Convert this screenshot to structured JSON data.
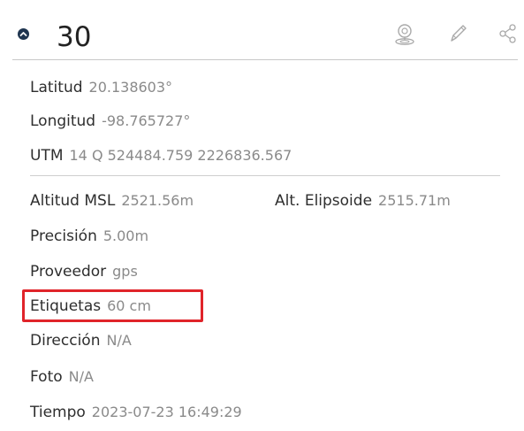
{
  "header": {
    "title": "30",
    "icons": [
      "location-pin-icon",
      "pencil-icon",
      "share-icon"
    ]
  },
  "fields": {
    "latitud": {
      "label": "Latitud",
      "value": "20.138603°"
    },
    "longitud": {
      "label": "Longitud",
      "value": "-98.765727°"
    },
    "utm": {
      "label": "UTM",
      "value": "14 Q 524484.759 2226836.567"
    },
    "altitud_msl": {
      "label": "Altitud MSL",
      "value": "2521.56m"
    },
    "alt_elipsoide": {
      "label": "Alt. Elipsoide",
      "value": "2515.71m"
    },
    "precision": {
      "label": "Precisión",
      "value": "5.00m"
    },
    "proveedor": {
      "label": "Proveedor",
      "value": "gps"
    },
    "etiquetas": {
      "label": "Etiquetas",
      "value": "60 cm"
    },
    "direccion": {
      "label": "Dirección",
      "value": "N/A"
    },
    "foto": {
      "label": "Foto",
      "value": "N/A"
    },
    "tiempo": {
      "label": "Tiempo",
      "value": "2023-07-23 16:49:29"
    }
  },
  "colors": {
    "highlight": "#e0242a",
    "collapse_button": "#1f3550"
  }
}
